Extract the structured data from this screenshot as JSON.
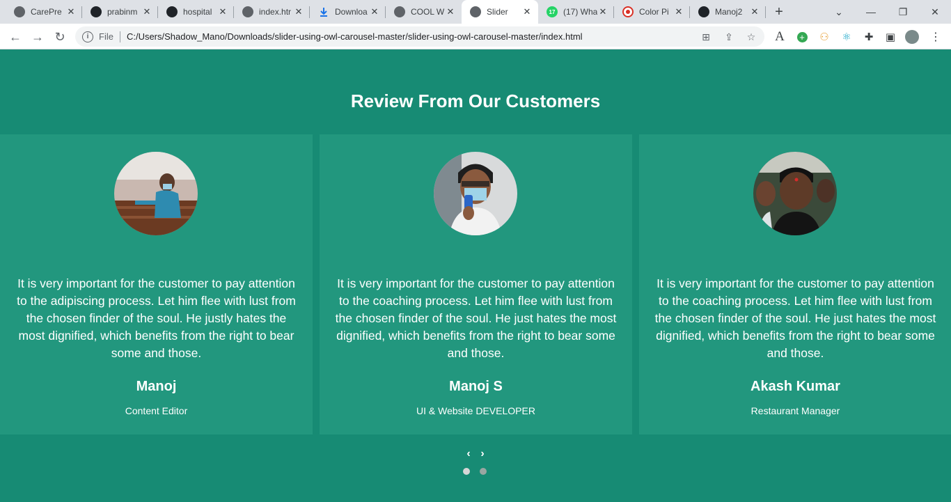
{
  "browser": {
    "tabs": [
      {
        "title": "CarePre",
        "icon": "globe-icon",
        "active": false
      },
      {
        "title": "prabinm",
        "icon": "github-icon",
        "active": false
      },
      {
        "title": "hospital",
        "icon": "github-icon",
        "active": false
      },
      {
        "title": "index.htr",
        "icon": "globe-icon",
        "active": false
      },
      {
        "title": "Downloa",
        "icon": "download-icon",
        "active": false
      },
      {
        "title": "COOL W",
        "icon": "globe-icon",
        "active": false
      },
      {
        "title": "Slider",
        "icon": "globe-icon",
        "active": true
      },
      {
        "title": "(17) Wha",
        "icon": "whatsapp-icon",
        "badge": "17",
        "active": false
      },
      {
        "title": "Color Pi",
        "icon": "color-picker-icon",
        "active": false
      },
      {
        "title": "Manoj2",
        "icon": "github-icon",
        "active": false
      }
    ],
    "address": {
      "scheme": "File",
      "url": "C:/Users/Shadow_Mano/Downloads/slider-using-owl-carousel-master/slider-using-owl-carousel-master/index.html"
    }
  },
  "page": {
    "heading": "Review From Our Customers",
    "testimonials": [
      {
        "quote": "It is very important for the customer to pay attention to the adipiscing process. Let him flee with lust from the chosen finder of the soul. He justly hates the most dignified, which benefits from the right to bear some and those.",
        "name": "Manoj",
        "role": "Content Editor"
      },
      {
        "quote": "It is very important for the customer to pay attention to the coaching process. Let him flee with lust from the chosen finder of the soul. He just hates the most dignified, which benefits from the right to bear some and those.",
        "name": "Manoj S",
        "role": "UI & Website DEVELOPER"
      },
      {
        "quote": "It is very important for the customer to pay attention to the coaching process. Let him flee with lust from the chosen finder of the soul. He just hates the most dignified, which benefits from the right to bear some and those.",
        "name": "Akash Kumar",
        "role": "Restaurant Manager"
      }
    ],
    "nav": {
      "prev": "‹",
      "next": "›"
    },
    "dots": {
      "count": 2,
      "active_index": 0
    }
  },
  "colors": {
    "page_bg": "#178b74",
    "card_bg": "#22977e",
    "text": "#ffffff"
  }
}
